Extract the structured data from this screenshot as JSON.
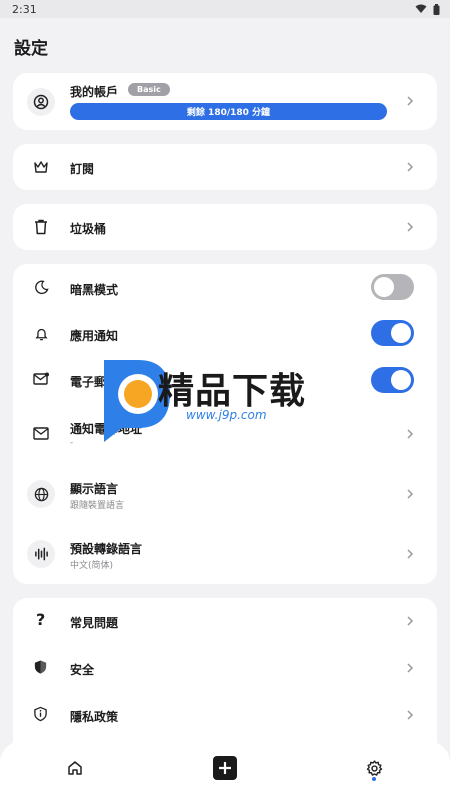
{
  "status_bar": {
    "time": "2:31"
  },
  "page": {
    "title": "設定"
  },
  "account": {
    "label": "我的帳戶",
    "plan_badge": "Basic",
    "remaining": "剩餘 180/180 分鐘",
    "remaining_fraction": 1.0
  },
  "subscription": {
    "label": "訂閱"
  },
  "trash": {
    "label": "垃圾桶"
  },
  "preferences": {
    "dark_mode": {
      "label": "暗黑模式",
      "enabled": false
    },
    "app_notifications": {
      "label": "應用通知",
      "enabled": true
    },
    "email_notifications": {
      "label": "電子郵件通知",
      "enabled": true
    },
    "notification_email": {
      "label": "通知電郵地址",
      "value": "-"
    },
    "display_language": {
      "label": "顯示語言",
      "value": "跟隨裝置語言"
    },
    "default_transcription_language": {
      "label": "預設轉錄語言",
      "value": "中文(简体)"
    }
  },
  "help": {
    "faq": {
      "label": "常見問題"
    },
    "security": {
      "label": "安全"
    },
    "privacy": {
      "label": "隱私政策"
    }
  },
  "watermark": {
    "title": "精品下载",
    "url": "www.j9p.com"
  },
  "colors": {
    "accent": "#2f6fe6",
    "background": "#f2f2f4",
    "card": "#ffffff"
  }
}
